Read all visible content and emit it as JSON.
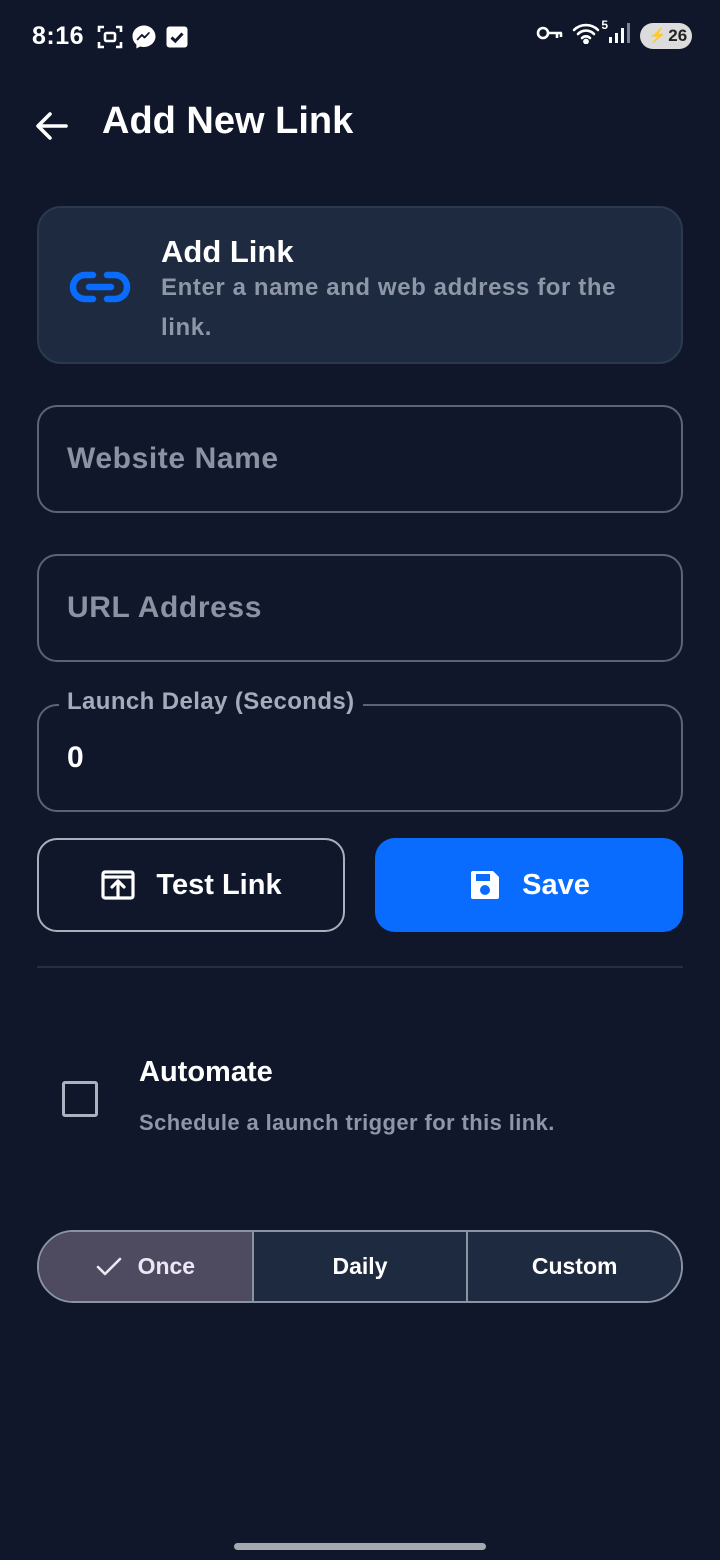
{
  "status_bar": {
    "time": "8:16",
    "left_icons": [
      "screenshot-icon",
      "messenger-icon",
      "check-square-icon"
    ],
    "right_icons": [
      "key-icon",
      "wifi-icon",
      "signal-icon"
    ],
    "wifi_badge": "5",
    "battery": "26"
  },
  "header": {
    "title": "Add New Link"
  },
  "info_card": {
    "title": "Add Link",
    "description": "Enter a name and web address for the link.",
    "icon": "link-icon"
  },
  "form": {
    "website_name": {
      "placeholder": "Website Name",
      "value": ""
    },
    "url_address": {
      "placeholder": "URL Address",
      "value": ""
    },
    "launch_delay": {
      "label": "Launch Delay (Seconds)",
      "value": "0"
    }
  },
  "actions": {
    "test_label": "Test Link",
    "save_label": "Save"
  },
  "automate": {
    "title": "Automate",
    "description": "Schedule a launch trigger for this link.",
    "checked": false
  },
  "schedule": {
    "options": [
      "Once",
      "Daily",
      "Custom"
    ],
    "selected": "Once"
  },
  "colors": {
    "background": "#10172a",
    "card": "#1e2a3f",
    "accent": "#0a6cff",
    "selected_segment": "#4e4a5f"
  }
}
